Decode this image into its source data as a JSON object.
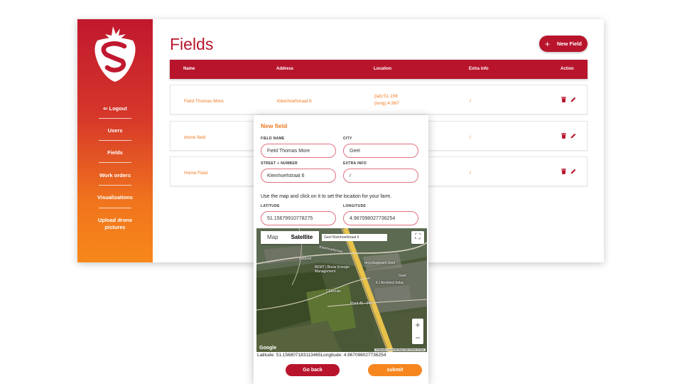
{
  "colors": {
    "primary": "#b8152d",
    "accent": "#ef7a22",
    "sidebar_top": "#c0182e",
    "sidebar_bottom": "#f7881a"
  },
  "sidebar": {
    "logo_icon": "strawberry-s-logo",
    "logout": {
      "icon": "logout-icon",
      "label": "Logout"
    },
    "items": [
      {
        "label": "Users"
      },
      {
        "label": "Fields"
      },
      {
        "label": "Work orders"
      },
      {
        "label": "Visualizations"
      },
      {
        "label": "Upload drone pictures"
      }
    ]
  },
  "header": {
    "title": "Fields",
    "new_button": {
      "icon": "plus-icon",
      "label": "New Field"
    }
  },
  "table": {
    "columns": [
      "Name",
      "Address",
      "Location",
      "Extra info",
      "Action"
    ],
    "rows": [
      {
        "name": "Field Thomas More",
        "address": "Kleinhoefstraat 6",
        "location_lat": "(lat):51.156",
        "location_long": "(long):4.967",
        "extra": "/"
      },
      {
        "name": "drone field",
        "address": "",
        "location_lat": "",
        "location_long": "",
        "extra": "/"
      },
      {
        "name": "Home Field",
        "address": "",
        "location_lat": "",
        "location_long": "",
        "extra": "/"
      }
    ],
    "action_icons": [
      "trash-icon",
      "pencil-icon"
    ]
  },
  "modal": {
    "title": "New field",
    "fields": {
      "field_name": {
        "label": "FIELD NAME",
        "value": "Field Thomas More"
      },
      "city": {
        "label": "CITY",
        "value": "Geel"
      },
      "street": {
        "label": "STREET + NUMBER",
        "value": "Kleinhoefstraat 6"
      },
      "extra_info": {
        "label": "EXTRA INFO",
        "value": "/"
      },
      "latitude": {
        "label": "LATITUDE",
        "value": "51.15679910778275"
      },
      "longitude": {
        "label": "LONGITUDE",
        "value": "4.967098027736254"
      }
    },
    "map_hint": "Use the map and click on it to set the location for your farm.",
    "map": {
      "tabs": [
        "Map",
        "Satellite"
      ],
      "active_tab": "Satellite",
      "search_text": "Geel Kleinhoefstraat 6",
      "zoom_in": "+",
      "zoom_out": "−",
      "brand": "Google",
      "attribution": "Keyboard shortcuts   Map Data   Terms of Use",
      "pois": [
        "Bedoret",
        "BEMT | Bouw Energie Management",
        "recyclagepark Geel",
        "KJ Architect bvba",
        "CERcuits",
        "Pivot 45 - 246"
      ],
      "roads": [
        "Kleinhoefstraat",
        "Geel"
      ]
    },
    "coords_line": "Latitude: 51.156807183113465Longitude: 4.967098027736254",
    "back_label": "Go back",
    "submit_label": "submit"
  }
}
